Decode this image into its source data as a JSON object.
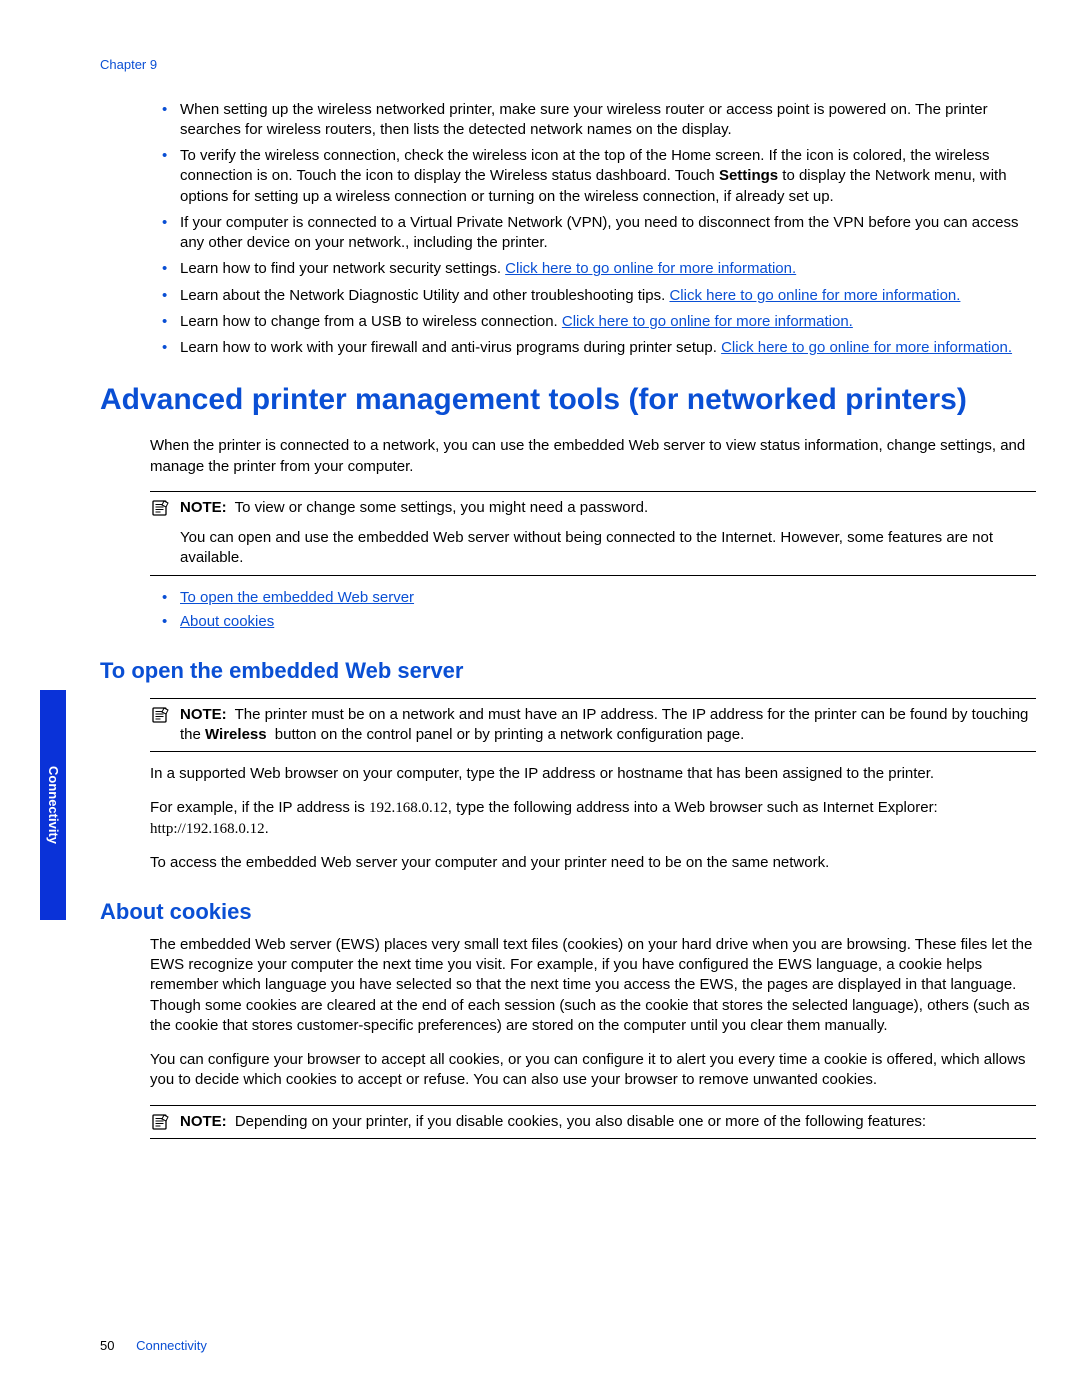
{
  "chapter_header": "Chapter 9",
  "top_bullets": [
    {
      "segments": [
        {
          "type": "text",
          "value": "When setting up the wireless networked printer, make sure your wireless router or access point is powered on. The printer searches for wireless routers, then lists the detected network names on the display."
        }
      ]
    },
    {
      "segments": [
        {
          "type": "text",
          "value": "To verify the wireless connection, check the wireless icon at the top of the Home screen. If the icon is colored, the wireless connection is on. Touch the icon to display the Wireless status dashboard. Touch "
        },
        {
          "type": "bold",
          "value": "Settings"
        },
        {
          "type": "text",
          "value": " to display the Network menu, with options for setting up a wireless connection or turning on the wireless connection, if already set up."
        }
      ]
    },
    {
      "segments": [
        {
          "type": "text",
          "value": "If your computer is connected to a Virtual Private Network (VPN), you need to disconnect from the VPN before you can access any other device on your network., including the printer."
        }
      ]
    },
    {
      "segments": [
        {
          "type": "text",
          "value": "Learn how to find your network security settings. "
        },
        {
          "type": "link",
          "value": "Click here to go online for more information."
        }
      ]
    },
    {
      "segments": [
        {
          "type": "text",
          "value": "Learn about the Network Diagnostic Utility and other troubleshooting tips. "
        },
        {
          "type": "link",
          "value": "Click here to go online for more information."
        }
      ]
    },
    {
      "segments": [
        {
          "type": "text",
          "value": "Learn how to change from a USB to wireless connection. "
        },
        {
          "type": "link",
          "value": "Click here to go online for more information."
        }
      ]
    },
    {
      "segments": [
        {
          "type": "text",
          "value": "Learn how to work with your firewall and anti-virus programs during printer setup. "
        },
        {
          "type": "link",
          "value": "Click here to go online for more information."
        }
      ]
    }
  ],
  "section_title": "Advanced printer management tools (for networked printers)",
  "intro_para": "When the printer is connected to a network, you can use the embedded Web server to view status information, change settings, and manage the printer from your computer.",
  "note1_label": "NOTE:",
  "note1_line1": "To view or change some settings, you might need a password.",
  "note1_line2": "You can open and use the embedded Web server without being connected to the Internet. However, some features are not available.",
  "link_list": [
    "To open the embedded Web server",
    "About cookies"
  ],
  "subsection1_title": "To open the embedded Web server",
  "note2_label": "NOTE:",
  "note2_segments": [
    {
      "type": "text",
      "value": "The printer must be on a network and must have an IP address. The IP address for the printer can be found by touching the "
    },
    {
      "type": "bold",
      "value": "Wireless"
    },
    {
      "type": "text",
      "value": " button on the control panel or by printing a network configuration page."
    }
  ],
  "sub1_para1": "In a supported Web browser on your computer, type the IP address or hostname that has been assigned to the printer.",
  "sub1_para2_a": "For example, if the IP address is ",
  "sub1_para2_ip": "192.168.0.12",
  "sub1_para2_b": ", type the following address into a Web browser such as Internet Explorer: ",
  "sub1_para2_url": "http://192.168.0.12",
  "sub1_para2_c": ".",
  "sub1_para3": "To access the embedded Web server your computer and your printer need to be on the same network.",
  "subsection2_title": "About cookies",
  "sub2_para1": "The embedded Web server (EWS) places very small text files (cookies) on your hard drive when you are browsing. These files let the EWS recognize your computer the next time you visit. For example, if you have configured the EWS language, a cookie helps remember which language you have selected so that the next time you access the EWS, the pages are displayed in that language. Though some cookies are cleared at the end of each session (such as the cookie that stores the selected language), others (such as the cookie that stores customer-specific preferences) are stored on the computer until you clear them manually.",
  "sub2_para2": "You can configure your browser to accept all cookies, or you can configure it to alert you every time a cookie is offered, which allows you to decide which cookies to accept or refuse. You can also use your browser to remove unwanted cookies.",
  "note3_label": "NOTE:",
  "note3_body": "Depending on your printer, if you disable cookies, you also disable one or more of the following features:",
  "sidebar_label": "Connectivity",
  "page_number": "50",
  "footer_title": "Connectivity"
}
